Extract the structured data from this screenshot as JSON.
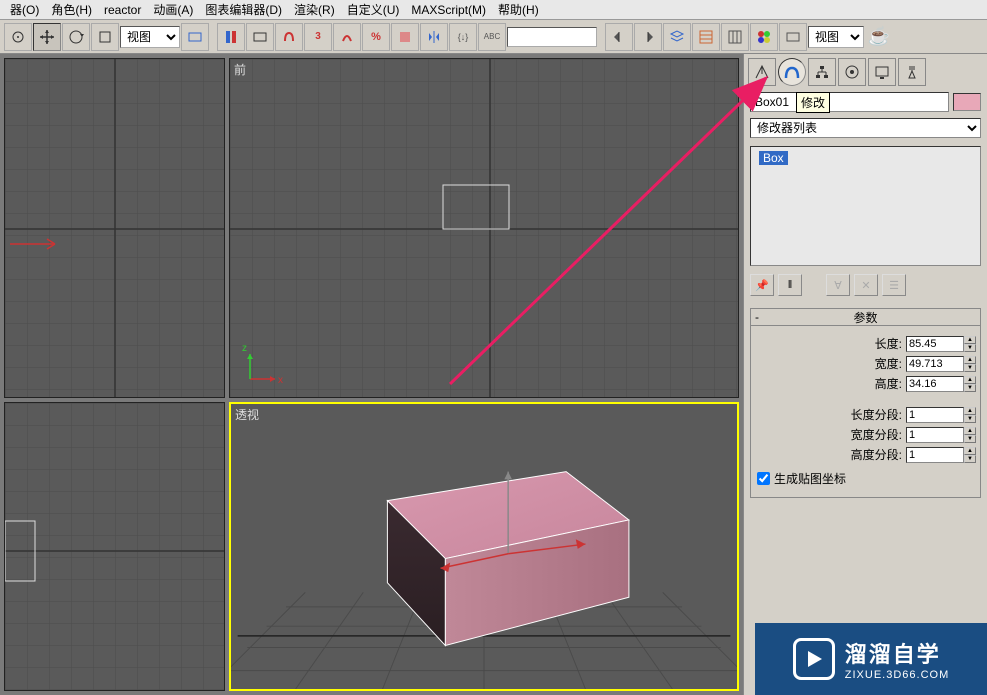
{
  "menu": {
    "items": [
      "器(O)",
      "角色(H)",
      "reactor",
      "动画(A)",
      "图表编辑器(D)",
      "渲染(R)",
      "自定义(U)",
      "MAXScript(M)",
      "帮助(H)"
    ]
  },
  "toolbar": {
    "viewmode_a": "视图",
    "viewmode_b": "视图"
  },
  "viewports": {
    "top_label": "",
    "front_label": "前",
    "left_label": "",
    "persp_label": "透视",
    "axis_x": "x",
    "axis_z": "z"
  },
  "panel": {
    "tooltip": "修改",
    "object_name": "Box01",
    "modifier_list": "修改器列表",
    "stack_item": "Box",
    "rollup_title": "参数",
    "params": {
      "length_label": "长度:",
      "length_value": "85.45",
      "width_label": "宽度:",
      "width_value": "49.713",
      "height_label": "高度:",
      "height_value": "34.16",
      "lseg_label": "长度分段:",
      "lseg_value": "1",
      "wseg_label": "宽度分段:",
      "wseg_value": "1",
      "hseg_label": "高度分段:",
      "hseg_value": "1",
      "genmap_label": "生成贴图坐标"
    }
  },
  "watermark": {
    "title": "溜溜自学",
    "sub": "ZIXUE.3D66.COM"
  }
}
